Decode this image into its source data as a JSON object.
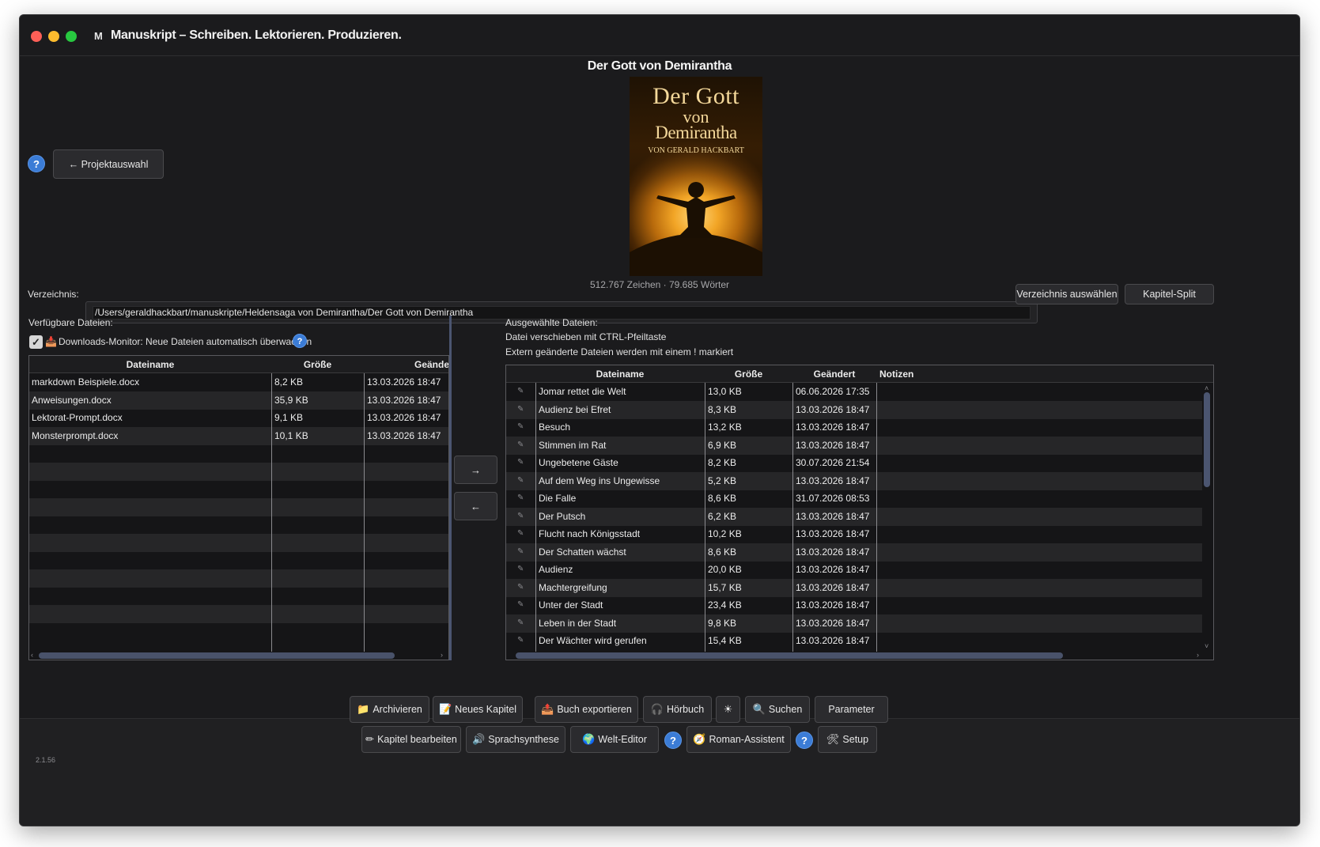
{
  "window": {
    "app_letter": "M",
    "title": "Manuskript – Schreiben. Lektorieren. Produzieren."
  },
  "book": {
    "title": "Der Gott von Demirantha",
    "cover_line1": "Der Gott",
    "cover_line2": "von",
    "cover_line3": "Demirantha",
    "cover_author": "VON GERALD HACKBART",
    "stats": "512.767 Zeichen · 79.685 Wörter"
  },
  "nav": {
    "help": "?",
    "back_label": "← Projektauswahl"
  },
  "directory": {
    "label": "Verzeichnis:",
    "path": "/Users/geraldhackbart/manuskripte/Heldensaga von Demirantha/Der Gott von Demirantha",
    "select_button": "Verzeichnis auswählen",
    "split_button": "Kapitel-Split"
  },
  "available": {
    "label": "Verfügbare Dateien:",
    "monitor_check": "✓",
    "monitor_icon": "📥",
    "monitor_label": "Downloads-Monitor: Neue Dateien automatisch überwachen",
    "help": "?",
    "columns": [
      "Dateiname",
      "Größe",
      "Geänder"
    ],
    "rows": [
      {
        "name": "markdown Beispiele.docx",
        "size": "8,2 KB",
        "date": "13.03.2026 18:47"
      },
      {
        "name": "Anweisungen.docx",
        "size": "35,9 KB",
        "date": "13.03.2026 18:47"
      },
      {
        "name": "Lektorat-Prompt.docx",
        "size": "9,1 KB",
        "date": "13.03.2026 18:47"
      },
      {
        "name": "Monsterprompt.docx",
        "size": "10,1 KB",
        "date": "13.03.2026 18:47"
      }
    ]
  },
  "transfer": {
    "right": "→",
    "left": "←"
  },
  "selected": {
    "label": "Ausgewählte Dateien:",
    "hint1": "Datei verschieben mit CTRL-Pfeiltaste",
    "hint2": "Extern geänderte Dateien werden mit einem ! markiert",
    "columns": [
      "Dateiname",
      "Größe",
      "Geändert",
      "Notizen"
    ],
    "rows": [
      {
        "name": "Jomar rettet die Welt",
        "size": "13,0 KB",
        "date": "06.06.2026 17:35"
      },
      {
        "name": "Audienz bei Efret",
        "size": "8,3 KB",
        "date": "13.03.2026 18:47"
      },
      {
        "name": "Besuch",
        "size": "13,2 KB",
        "date": "13.03.2026 18:47"
      },
      {
        "name": "Stimmen im Rat",
        "size": "6,9 KB",
        "date": "13.03.2026 18:47"
      },
      {
        "name": "Ungebetene Gäste",
        "size": "8,2 KB",
        "date": "30.07.2026 21:54"
      },
      {
        "name": "Auf dem Weg ins Ungewisse",
        "size": "5,2 KB",
        "date": "13.03.2026 18:47"
      },
      {
        "name": "Die Falle",
        "size": "8,6 KB",
        "date": "31.07.2026 08:53"
      },
      {
        "name": "Der Putsch",
        "size": "6,2 KB",
        "date": "13.03.2026 18:47"
      },
      {
        "name": "Flucht nach Königsstadt",
        "size": "10,2 KB",
        "date": "13.03.2026 18:47"
      },
      {
        "name": "Der Schatten wächst",
        "size": "8,6 KB",
        "date": "13.03.2026 18:47"
      },
      {
        "name": "Audienz",
        "size": "20,0 KB",
        "date": "13.03.2026 18:47"
      },
      {
        "name": "Machtergreifung",
        "size": "15,7 KB",
        "date": "13.03.2026 18:47"
      },
      {
        "name": "Unter der Stadt",
        "size": "23,4 KB",
        "date": "13.03.2026 18:47"
      },
      {
        "name": "Leben in der Stadt",
        "size": "9,8 KB",
        "date": "13.03.2026 18:47"
      },
      {
        "name": "Der Wächter wird gerufen",
        "size": "15,4 KB",
        "date": "13.03.2026 18:47"
      }
    ],
    "edit_icon": "✎"
  },
  "toolbar": {
    "row1": [
      {
        "icon": "📁",
        "label": "Archivieren"
      },
      {
        "icon": "📝",
        "label": "Neues Kapitel"
      },
      {
        "icon": "📤",
        "label": "Buch exportieren"
      },
      {
        "icon": "🎧",
        "label": "Hörbuch"
      },
      {
        "icon": "☀",
        "label": ""
      },
      {
        "icon": "🔍",
        "label": "Suchen"
      },
      {
        "icon": "",
        "label": "Parameter"
      }
    ],
    "row2": [
      {
        "icon": "✏",
        "label": "Kapitel bearbeiten"
      },
      {
        "icon": "🔊",
        "label": "Sprachsynthese"
      },
      {
        "icon": "🌍",
        "label": "Welt-Editor"
      },
      {
        "icon": "?",
        "label": ""
      },
      {
        "icon": "🧭",
        "label": "Roman-Assistent"
      },
      {
        "icon": "?",
        "label": ""
      },
      {
        "icon": "🛠",
        "label": "Setup"
      }
    ]
  },
  "version": "2.1.56"
}
